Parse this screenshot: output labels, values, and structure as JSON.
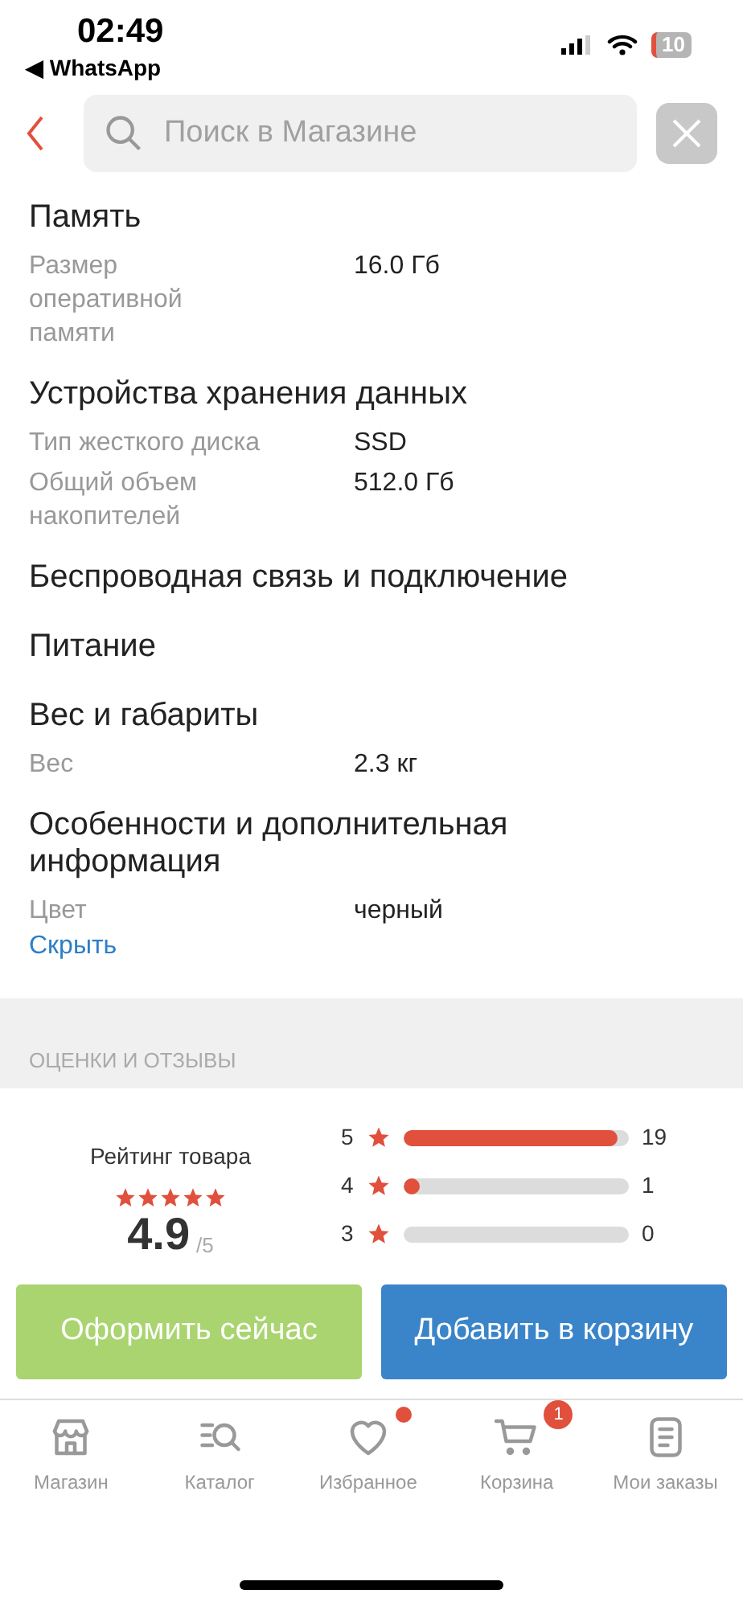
{
  "status_bar": {
    "time": "02:49",
    "back_app": "◀ WhatsApp",
    "battery": "10"
  },
  "search": {
    "placeholder": "Поиск в Магазине"
  },
  "spec_sections": [
    {
      "title": "Память",
      "rows": [
        {
          "label": "Размер оперативной памяти",
          "value": "16.0 Гб"
        }
      ]
    },
    {
      "title": "Устройства хранения данных",
      "rows": [
        {
          "label": "Тип жесткого диска",
          "value": "SSD"
        },
        {
          "label": "Общий объем накопителей",
          "value": "512.0 Гб"
        }
      ]
    },
    {
      "title": "Беспроводная связь и подключение"
    },
    {
      "title": "Питание"
    },
    {
      "title": "Вес и габариты",
      "rows": [
        {
          "label": "Вес",
          "value": "2.3 кг"
        }
      ]
    },
    {
      "title": "Особенности и дополнительная информация",
      "rows": [
        {
          "label": "Цвет",
          "value": "черный"
        }
      ]
    }
  ],
  "hide_link": "Скрыть",
  "reviews": {
    "heading": "ОЦЕНКИ И ОТЗЫВЫ",
    "rating_label": "Рейтинг товара",
    "stars": 5,
    "score": "4.9",
    "max": "/5",
    "bars": [
      {
        "grade": "5",
        "level": 0.95,
        "count": "19"
      },
      {
        "grade": "4",
        "level": 0.05,
        "count": "1"
      },
      {
        "grade": "3",
        "level": 0,
        "count": "0"
      }
    ]
  },
  "buttons": [
    {
      "kind": "buy_now",
      "label": "Оформить сейчас"
    },
    {
      "kind": "add_to_cart",
      "label": "Добавить в корзину"
    }
  ],
  "tabs": [
    {
      "kind": "store",
      "label": "Магазин",
      "selected": false,
      "dot": false
    },
    {
      "kind": "catalog",
      "label": "Каталог",
      "selected": false,
      "dot": false
    },
    {
      "kind": "favorites",
      "label": "Избранное",
      "selected": false,
      "dot": true
    },
    {
      "kind": "cart",
      "label": "Корзина",
      "selected": false,
      "dot": false,
      "badge": "1"
    },
    {
      "kind": "orders",
      "label": "Мои заказы",
      "selected": false,
      "dot": false
    }
  ]
}
